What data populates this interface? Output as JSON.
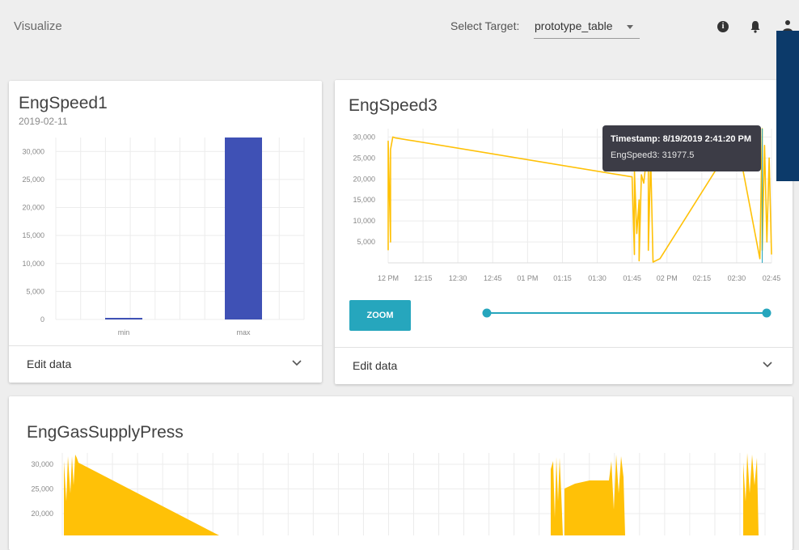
{
  "header": {
    "app_title": "Visualize",
    "target_label": "Select Target:",
    "target_value": "prototype_table",
    "icons": [
      "info-icon",
      "bell-icon",
      "user-icon"
    ]
  },
  "cards": {
    "engspeed1": {
      "title": "EngSpeed1",
      "subtitle": "2019-02-11",
      "footer_label": "Edit data"
    },
    "engspeed3": {
      "title": "EngSpeed3",
      "footer_label": "Edit data",
      "zoom_label": "ZOOM",
      "tooltip_timestamp": "Timestamp: 8/19/2019 2:41:20 PM",
      "tooltip_value": "EngSpeed3: 31977.5"
    },
    "enggas": {
      "title": "EngGasSupplyPress"
    }
  },
  "colors": {
    "bar": "#3f51b5",
    "line": "#ffc107",
    "zoom": "#26a6bd",
    "slider": "#26a6bd",
    "overlay": "#0c3a6a"
  },
  "chart_data": [
    {
      "type": "bar",
      "title": "EngSpeed1",
      "subtitle": "2019-02-11",
      "categories": [
        "min",
        "max"
      ],
      "values": [
        0,
        32500
      ],
      "ylim": [
        0,
        32500
      ],
      "yticks": [
        "30,000",
        "25,000",
        "20,000",
        "15,000",
        "10,000",
        "5,000",
        "0"
      ],
      "grid": true
    },
    {
      "type": "line",
      "title": "EngSpeed3",
      "xticks": [
        "12 PM",
        "12:15",
        "12:30",
        "12:45",
        "01 PM",
        "01:15",
        "01:30",
        "01:45",
        "02 PM",
        "02:15",
        "02:30",
        "02:45"
      ],
      "yticks": [
        "30,000",
        "25,000",
        "20,000",
        "15,000",
        "10,000",
        "5,000"
      ],
      "xlim": [
        "12:00 PM",
        "2:45 PM"
      ],
      "ylim": [
        0,
        32000
      ],
      "x": [
        "12:00",
        "12:00",
        "12:01",
        "12:01",
        "12:02",
        "12:03",
        "13:45",
        "13:46",
        "13:46",
        "13:47",
        "13:48",
        "13:48",
        "13:49",
        "13:50",
        "13:52",
        "13:52",
        "13:53",
        "13:54",
        "13:57",
        "14:30",
        "14:40",
        "14:41",
        "14:41",
        "14:42",
        "14:43",
        "14:44",
        "14:45"
      ],
      "y": [
        3000,
        29000,
        5000,
        27000,
        30000,
        29800,
        20500,
        2000,
        22000,
        7000,
        15000,
        500,
        21000,
        19000,
        29000,
        3000,
        25000,
        200,
        1000,
        30000,
        1000,
        31977.5,
        3000,
        28000,
        5000,
        25000,
        2000
      ],
      "grid": true
    },
    {
      "type": "area",
      "title": "EngGasSupplyPress",
      "yticks": [
        "30,000",
        "25,000",
        "20,000"
      ],
      "grid": true
    }
  ]
}
